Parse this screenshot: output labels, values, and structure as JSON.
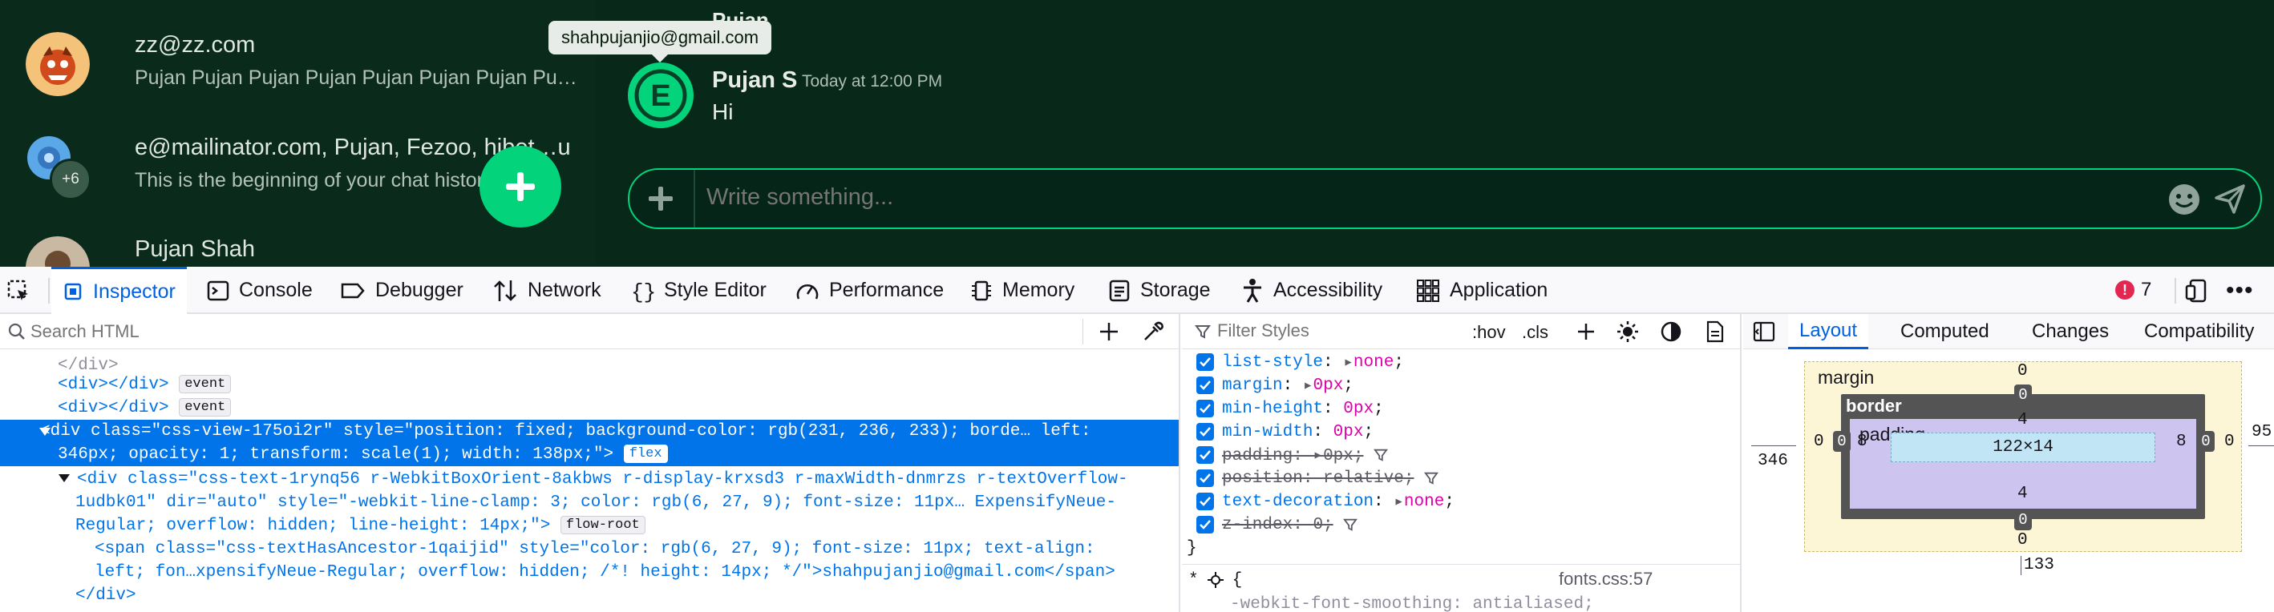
{
  "app": {
    "chats": [
      {
        "name": "zz@zz.com",
        "preview": "Pujan Pujan Pujan Pujan Pujan Pujan Pujan Pu…"
      },
      {
        "name": "e@mailinator.com, Pujan, Fezoo, hibet…u",
        "preview": "This is the beginning of your chat history",
        "extra_count": "+6"
      },
      {
        "name": "Pujan Shah",
        "preview": ""
      }
    ],
    "header_peek": "Pujan",
    "tooltip": "shahpujanjio@gmail.com",
    "message": {
      "author": "Pujan S",
      "time": "Today at 12:00 PM",
      "text": "Hi",
      "avatar_letter": "E"
    },
    "composer_placeholder": "Write something...",
    "accent": "#03d47c"
  },
  "devtools": {
    "tabs": [
      "Inspector",
      "Console",
      "Debugger",
      "Network",
      "Style Editor",
      "Performance",
      "Memory",
      "Storage",
      "Accessibility",
      "Application"
    ],
    "active_tab": "Inspector",
    "error_count": "7",
    "search_placeholder": "Search HTML",
    "html": {
      "line1_tag": "<div></div>",
      "line1_badge": "event",
      "line2_tag": "<div></div>",
      "line2_badge": "event",
      "sel_line1": "<div class=\"css-view-175oi2r\" style=\"position: fixed; background-color: rgb(231, 236, 233); borde… left:",
      "sel_line2": "346px; opacity: 1; transform: scale(1); width: 138px;\">",
      "sel_badge": "flex",
      "child_line1": "<div class=\"css-text-1rynq56 r-WebkitBoxOrient-8akbws r-display-krxsd3 r-maxWidth-dnmrzs r-textOverflow-",
      "child_line2": "1udbk01\" dir=\"auto\" style=\"-webkit-line-clamp: 3; color: rgb(6, 27, 9); font-size: 11px… ExpensifyNeue-",
      "child_line3": "Regular; overflow: hidden; line-height: 14px;\">",
      "child_badge": "flow-root",
      "span_line1": "<span class=\"css-textHasAncestor-1qaijid\" style=\"color: rgb(6, 27, 9); font-size: 11px; text-align:",
      "span_line2": "left; fon…xpensifyNeue-Regular; overflow: hidden; /*! height: 14px; */\">shahpujanjio@gmail.com</span>",
      "close_div": "</div>"
    },
    "rules": {
      "filter_placeholder": "Filter Styles",
      "hov": ":hov",
      "cls": ".cls",
      "props": [
        {
          "name": "list-style",
          "value": "none",
          "struck": false
        },
        {
          "name": "margin",
          "value": "0px",
          "struck": false
        },
        {
          "name": "min-height",
          "value": "0px",
          "struck": false
        },
        {
          "name": "min-width",
          "value": "0px",
          "struck": false
        },
        {
          "name": "padding",
          "value": "0px",
          "struck": true
        },
        {
          "name": "position",
          "value": "relative",
          "struck": true
        },
        {
          "name": "text-decoration",
          "value": "none",
          "struck": false
        },
        {
          "name": "z-index",
          "value": "0",
          "struck": true
        }
      ],
      "close_brace": "}",
      "next_selector": "* {",
      "next_source": "fonts.css:57",
      "next_prop": "-webkit-font-smoothing: antialiased;"
    },
    "layout": {
      "tabs": [
        "Layout",
        "Computed",
        "Changes",
        "Compatibility"
      ],
      "active": "Layout",
      "margin_label": "margin",
      "border_label": "border",
      "padding_label": "padding",
      "content_size": "122×14",
      "margin": {
        "top": "0",
        "right": "0",
        "bottom": "0",
        "left": "0"
      },
      "border": {
        "top": "0",
        "right": "0",
        "bottom": "0",
        "left": "0"
      },
      "padding": {
        "top": "4",
        "right": "8",
        "bottom": "4",
        "left": "8"
      },
      "position_left": "346",
      "position_right": "95",
      "position_bottom": "133"
    }
  }
}
